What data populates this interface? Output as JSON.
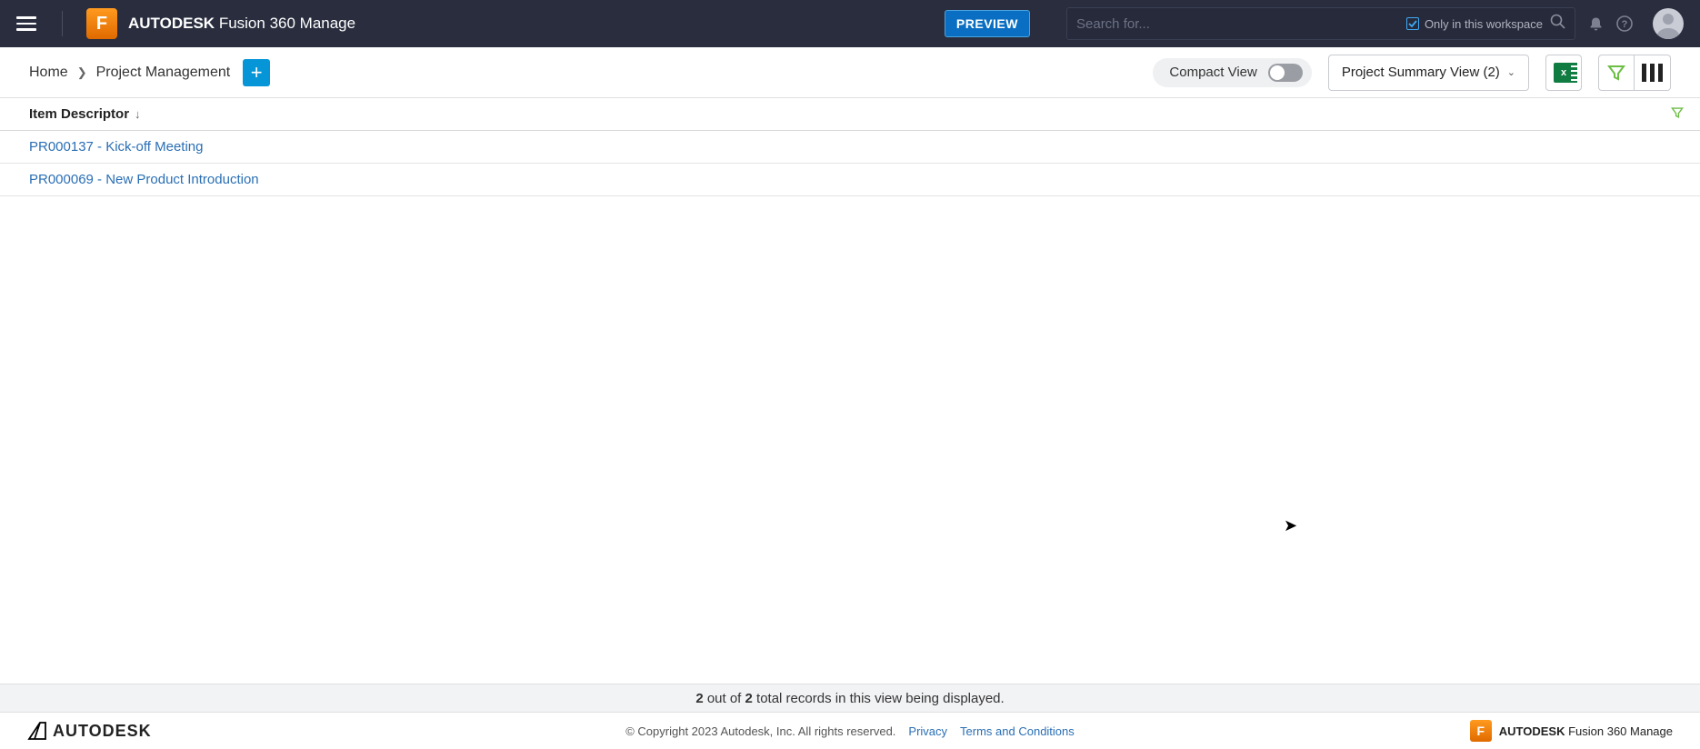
{
  "header": {
    "app_name_bold": "AUTODESK",
    "app_name_rest": " Fusion 360 Manage",
    "preview_label": "PREVIEW",
    "search_placeholder": "Search for...",
    "only_workspace_label": "Only in this workspace"
  },
  "toolbar": {
    "breadcrumbs": {
      "home": "Home",
      "current": "Project Management"
    },
    "compact_view_label": "Compact View",
    "view_selector_label": "Project Summary View (2)"
  },
  "grid": {
    "column_header": "Item Descriptor",
    "rows": [
      {
        "label": "PR000137 - Kick-off Meeting"
      },
      {
        "label": "PR000069 - New Product Introduction"
      }
    ]
  },
  "status": {
    "count": "2",
    "mid": " out of ",
    "total": "2",
    "suffix": " total records in this view being displayed."
  },
  "footer": {
    "logo_text": "AUTODESK",
    "copyright": "© Copyright 2023 Autodesk, Inc. All rights reserved.",
    "privacy": "Privacy",
    "terms": "Terms and Conditions",
    "right_bold": "AUTODESK",
    "right_rest": " Fusion 360 Manage"
  }
}
